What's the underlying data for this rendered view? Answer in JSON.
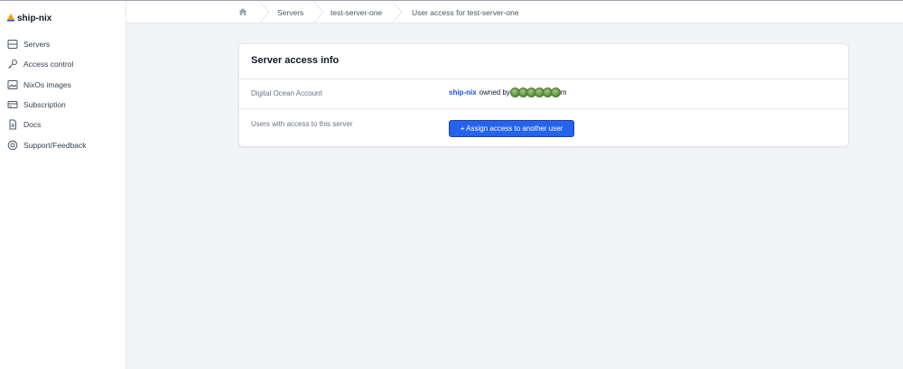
{
  "brand": {
    "name": "ship-nix",
    "logo_icon": "triangle-logo-icon"
  },
  "sidebar": {
    "items": [
      {
        "label": "Servers",
        "icon": "server-icon"
      },
      {
        "label": "Access control",
        "icon": "key-icon"
      },
      {
        "label": "NixOs images",
        "icon": "image-icon"
      },
      {
        "label": "Subscription",
        "icon": "credit-card-icon"
      },
      {
        "label": "Docs",
        "icon": "document-icon"
      },
      {
        "label": "Support/Feedback",
        "icon": "lifebuoy-icon"
      }
    ]
  },
  "breadcrumb": {
    "home_icon": "home-icon",
    "items": [
      "Servers",
      "test-server-one",
      "User access for test-server-one"
    ]
  },
  "card": {
    "title": "Server access info",
    "account_label": "Digital Ocean Account",
    "account_name": "ship-nix",
    "owned_by_text": "owned by",
    "owner_suffix": "m",
    "users_label": "Users with access to this server",
    "assign_button": "+ Assign access to another user"
  },
  "colors": {
    "primary": "#2563eb",
    "link": "#1d4ed8",
    "background": "#f3f4f6"
  }
}
